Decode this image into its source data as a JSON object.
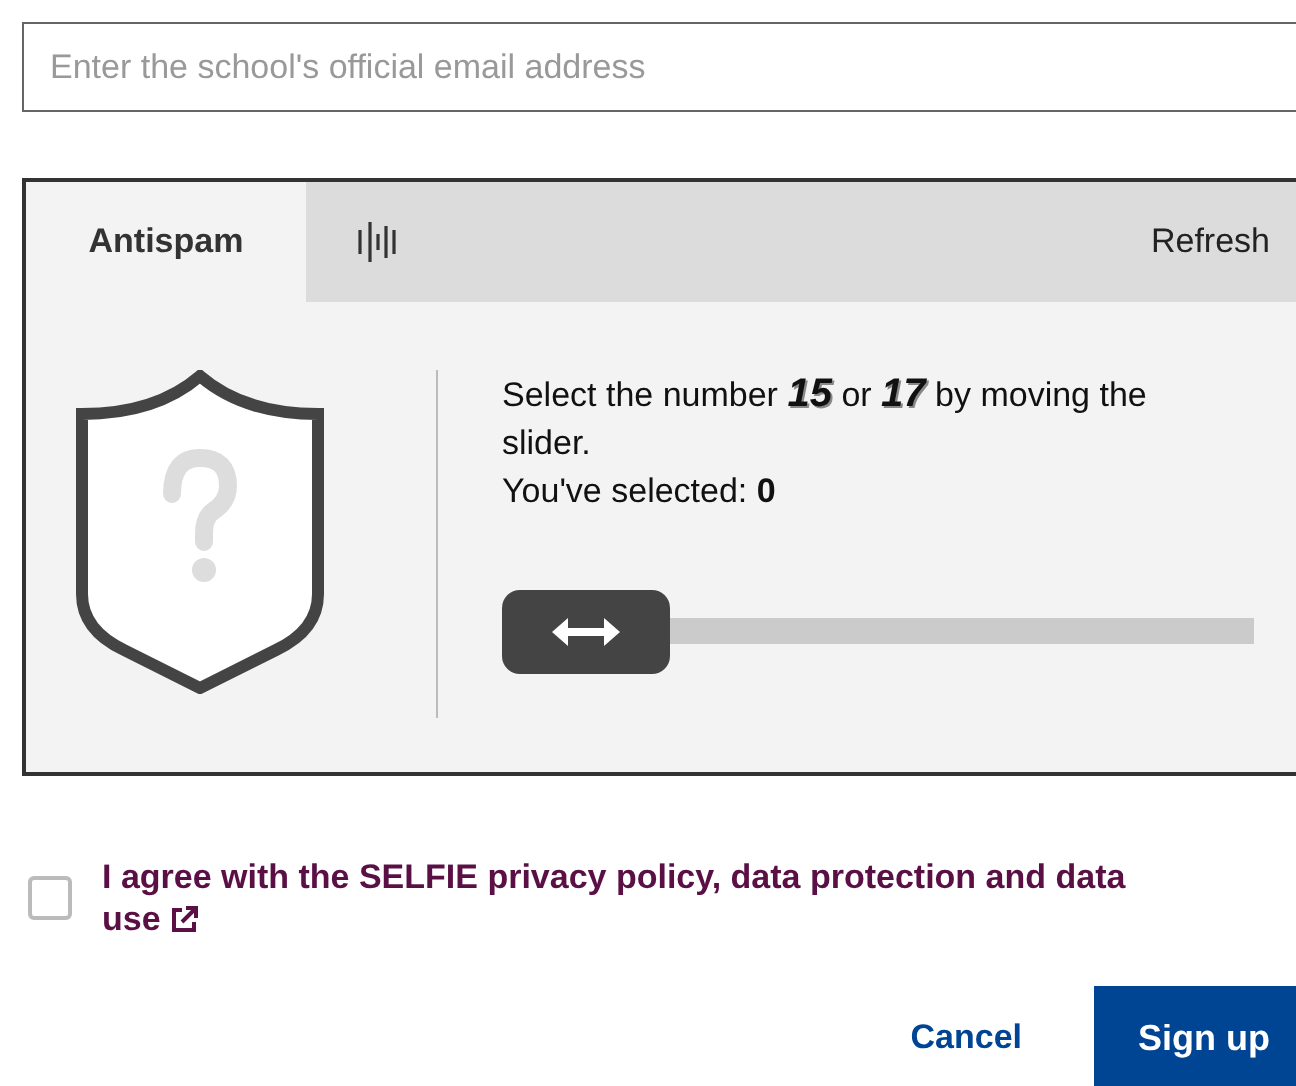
{
  "email_field": {
    "placeholder": "Enter the school's official email address"
  },
  "antispam": {
    "tabs": [
      {
        "label": "Antispam",
        "kind": "text",
        "selected": true
      },
      {
        "kind": "audio",
        "selected": false
      }
    ],
    "refresh": "Refresh",
    "instruction_before": "Select the number",
    "number_1": "15",
    "instruction_or": "or",
    "number_2": "17",
    "instruction_after": "by moving the slider.",
    "selected_label": "You've selected:",
    "selected_value": "0",
    "slider": {
      "level": 0
    }
  },
  "agreement": {
    "checked": false,
    "label": "I agree with the SELFIE privacy policy, data protection and data use"
  },
  "buttons": {
    "cancel": "Cancel",
    "submit": "Sign up"
  }
}
